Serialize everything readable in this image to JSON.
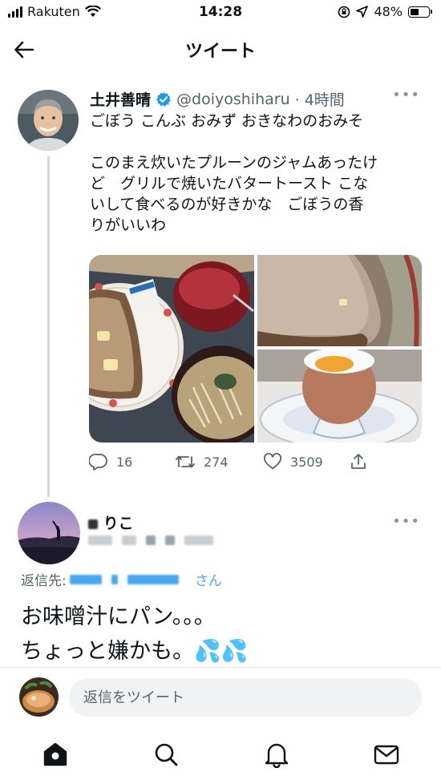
{
  "status_bar": {
    "carrier": "Rakuten",
    "time": "14:28",
    "battery": "48%",
    "battery_level": 0.48
  },
  "header": {
    "title": "ツイート",
    "back_icon": "arrow-left-icon"
  },
  "tweet": {
    "name": "土井善晴",
    "verified": true,
    "handle": "@doiyoshiharu",
    "time": "· 4時間",
    "lines": [
      "ごぼう こんぶ おみず おきなわのおみそ",
      "このまえ炊いたプルーンのジャムあったけ",
      "ど　グリルで焼いたバタートースト こな",
      "いして食べるのが好きかな　ごぼうの香",
      "りがいいわ"
    ],
    "stats": {
      "replies": "16",
      "retweets": "274",
      "likes": "3509"
    }
  },
  "reply": {
    "name_visible": "りこ",
    "replying_prefix": "返信先:",
    "replying_suffix": "さん",
    "line1": "お味噌汁にパン。。。",
    "line2": "ちょっと嫌かも。💦💦"
  },
  "composer": {
    "placeholder": "返信をツイート"
  },
  "colors": {
    "accent": "#1d9bf0",
    "muted": "#536471",
    "divider": "#e6ecf0"
  }
}
